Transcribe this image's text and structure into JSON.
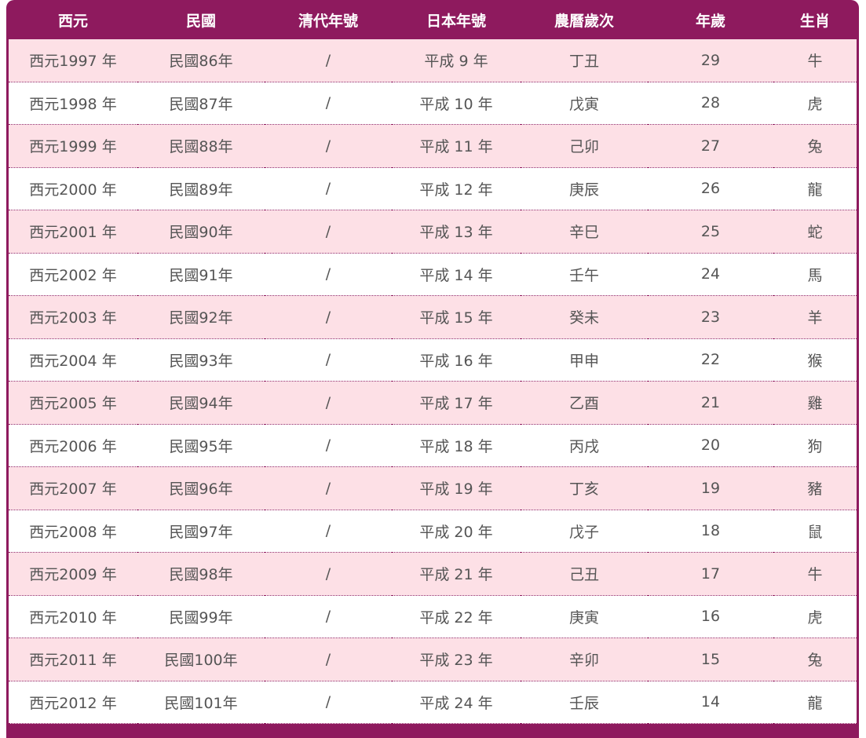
{
  "table": {
    "headers": [
      "西元",
      "民國",
      "清代年號",
      "日本年號",
      "農曆歲次",
      "年歲",
      "生肖"
    ],
    "rows": [
      [
        "西元1997 年",
        "民國86年",
        "/",
        "平成 9 年",
        "丁丑",
        "29",
        "牛"
      ],
      [
        "西元1998 年",
        "民國87年",
        "/",
        "平成 10 年",
        "戊寅",
        "28",
        "虎"
      ],
      [
        "西元1999 年",
        "民國88年",
        "/",
        "平成 11 年",
        "己卯",
        "27",
        "兔"
      ],
      [
        "西元2000 年",
        "民國89年",
        "/",
        "平成 12 年",
        "庚辰",
        "26",
        "龍"
      ],
      [
        "西元2001 年",
        "民國90年",
        "/",
        "平成 13 年",
        "辛巳",
        "25",
        "蛇"
      ],
      [
        "西元2002 年",
        "民國91年",
        "/",
        "平成 14 年",
        "壬午",
        "24",
        "馬"
      ],
      [
        "西元2003 年",
        "民國92年",
        "/",
        "平成 15 年",
        "癸未",
        "23",
        "羊"
      ],
      [
        "西元2004 年",
        "民國93年",
        "/",
        "平成 16 年",
        "甲申",
        "22",
        "猴"
      ],
      [
        "西元2005 年",
        "民國94年",
        "/",
        "平成 17 年",
        "乙酉",
        "21",
        "雞"
      ],
      [
        "西元2006 年",
        "民國95年",
        "/",
        "平成 18 年",
        "丙戌",
        "20",
        "狗"
      ],
      [
        "西元2007 年",
        "民國96年",
        "/",
        "平成 19 年",
        "丁亥",
        "19",
        "豬"
      ],
      [
        "西元2008 年",
        "民國97年",
        "/",
        "平成 20 年",
        "戊子",
        "18",
        "鼠"
      ],
      [
        "西元2009 年",
        "民國98年",
        "/",
        "平成 21 年",
        "己丑",
        "17",
        "牛"
      ],
      [
        "西元2010 年",
        "民國99年",
        "/",
        "平成 22 年",
        "庚寅",
        "16",
        "虎"
      ],
      [
        "西元2011 年",
        "民國100年",
        "/",
        "平成 23 年",
        "辛卯",
        "15",
        "兔"
      ],
      [
        "西元2012 年",
        "民國101年",
        "/",
        "平成 24 年",
        "壬辰",
        "14",
        "龍"
      ]
    ]
  },
  "colors": {
    "header_bg": "#8e1a5e",
    "row_alt_bg": "#fde0e6",
    "row_bg": "#ffffff",
    "text": "#555555"
  }
}
